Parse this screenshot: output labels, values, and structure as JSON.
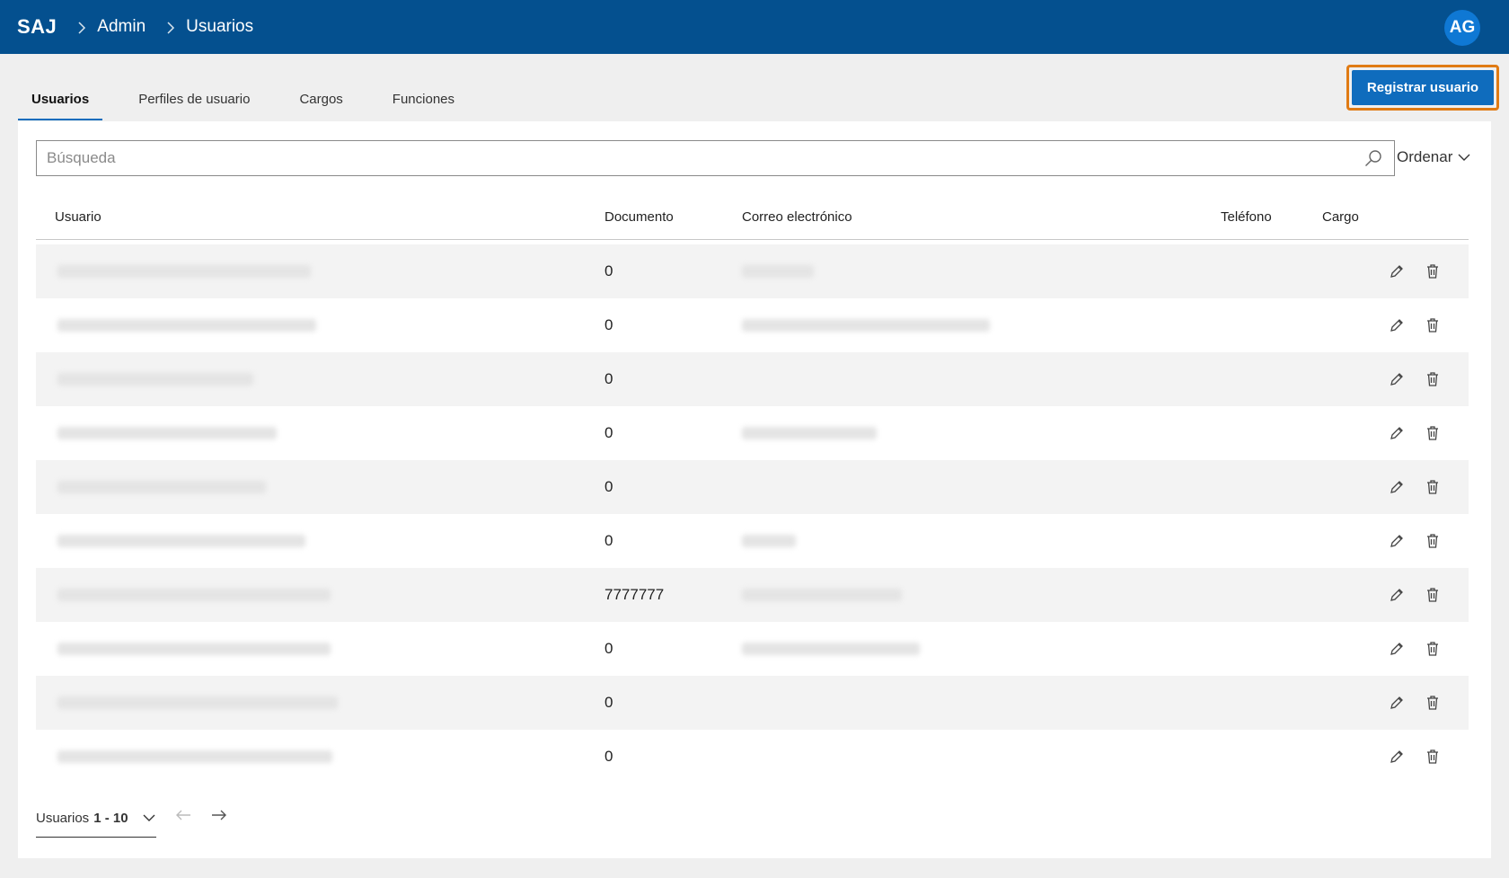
{
  "header": {
    "logo": "SAJ",
    "breadcrumb": [
      "Admin",
      "Usuarios"
    ],
    "avatar_initials": "AG"
  },
  "tabs": [
    {
      "label": "Usuarios",
      "active": true
    },
    {
      "label": "Perfiles de usuario",
      "active": false
    },
    {
      "label": "Cargos",
      "active": false
    },
    {
      "label": "Funciones",
      "active": false
    }
  ],
  "actions": {
    "register_label": "Registrar usuario"
  },
  "search": {
    "placeholder": "Búsqueda",
    "value": "",
    "icon": "search-icon"
  },
  "sort": {
    "label": "Ordenar"
  },
  "table": {
    "columns": [
      "Usuario",
      "Documento",
      "Correo electrónico",
      "Teléfono",
      "Cargo"
    ],
    "rows": [
      {
        "documento": "0",
        "has_email": true
      },
      {
        "documento": "0",
        "has_email": true
      },
      {
        "documento": "0",
        "has_email": false
      },
      {
        "documento": "0",
        "has_email": true
      },
      {
        "documento": "0",
        "has_email": false
      },
      {
        "documento": "0",
        "has_email": true
      },
      {
        "documento": "7777777",
        "has_email": true
      },
      {
        "documento": "0",
        "has_email": true
      },
      {
        "documento": "0",
        "has_email": false
      },
      {
        "documento": "0",
        "has_email": false
      }
    ]
  },
  "pagination": {
    "label": "Usuarios",
    "range": "1 - 10"
  },
  "colors": {
    "header_bg": "#04508f",
    "primary": "#0f6cbd",
    "highlight": "#e07b14"
  }
}
